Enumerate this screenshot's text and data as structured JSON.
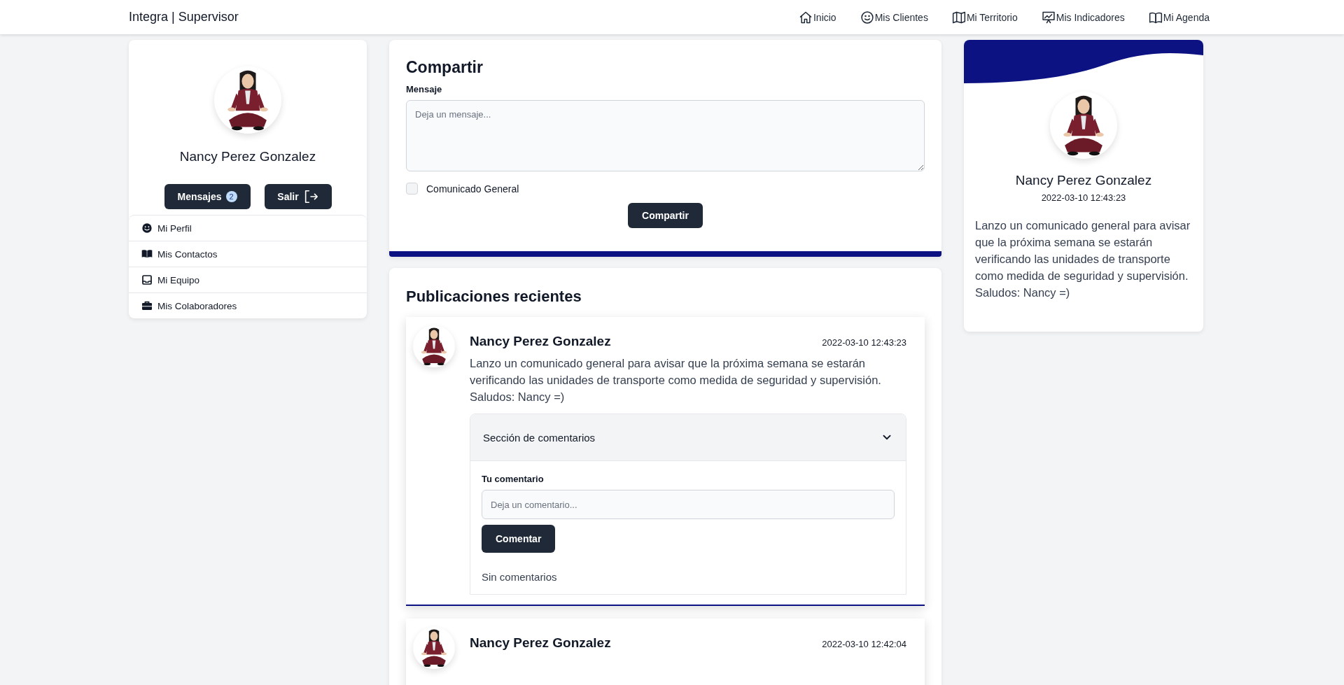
{
  "navbar": {
    "brand": "Integra | Supervisor",
    "links": [
      {
        "label": "Inicio"
      },
      {
        "label": "Mis Clientes"
      },
      {
        "label": "Mi Territorio"
      },
      {
        "label": "Mis Indicadores"
      },
      {
        "label": "Mi Agenda"
      }
    ]
  },
  "profile": {
    "name": "Nancy Perez Gonzalez",
    "messages_button": {
      "label": "Mensajes",
      "badge": "2"
    },
    "logout_button": {
      "label": "Salir"
    },
    "menu": [
      {
        "label": "Mi Perfil"
      },
      {
        "label": "Mis Contactos"
      },
      {
        "label": "Mi Equipo"
      },
      {
        "label": "Mis Colaboradores"
      }
    ]
  },
  "share": {
    "title": "Compartir",
    "message_label": "Mensaje",
    "placeholder": "Deja un mensaje...",
    "checkbox": {
      "label": "Comunicado General",
      "checked": false
    },
    "button": "Compartir"
  },
  "posts": {
    "title": "Publicaciones recientes",
    "items": [
      {
        "author": "Nancy Perez Gonzalez",
        "date": "2022-03-10 12:43:23",
        "body": "Lanzo un comunicado general para avisar que la próxima semana se estarán verificando las unidades de transporte como medida de seguridad y supervisión. Saludos: Nancy =)",
        "comments": {
          "title": "Sección de comentarios",
          "expanded": true,
          "label": "Tu comentario",
          "placeholder": "Deja un comentario...",
          "button": "Comentar",
          "empty": "Sin comentarios"
        }
      },
      {
        "author": "Nancy Perez Gonzalez",
        "date": "2022-03-10 12:42:04"
      }
    ]
  },
  "highlight": {
    "name": "Nancy Perez Gonzalez",
    "date": "2022-03-10 12:43:23",
    "body": "Lanzo un comunicado general para avisar que la próxima semana se estarán verificando las unidades de transporte como medida de seguridad y supervisión. Saludos: Nancy =)"
  }
}
